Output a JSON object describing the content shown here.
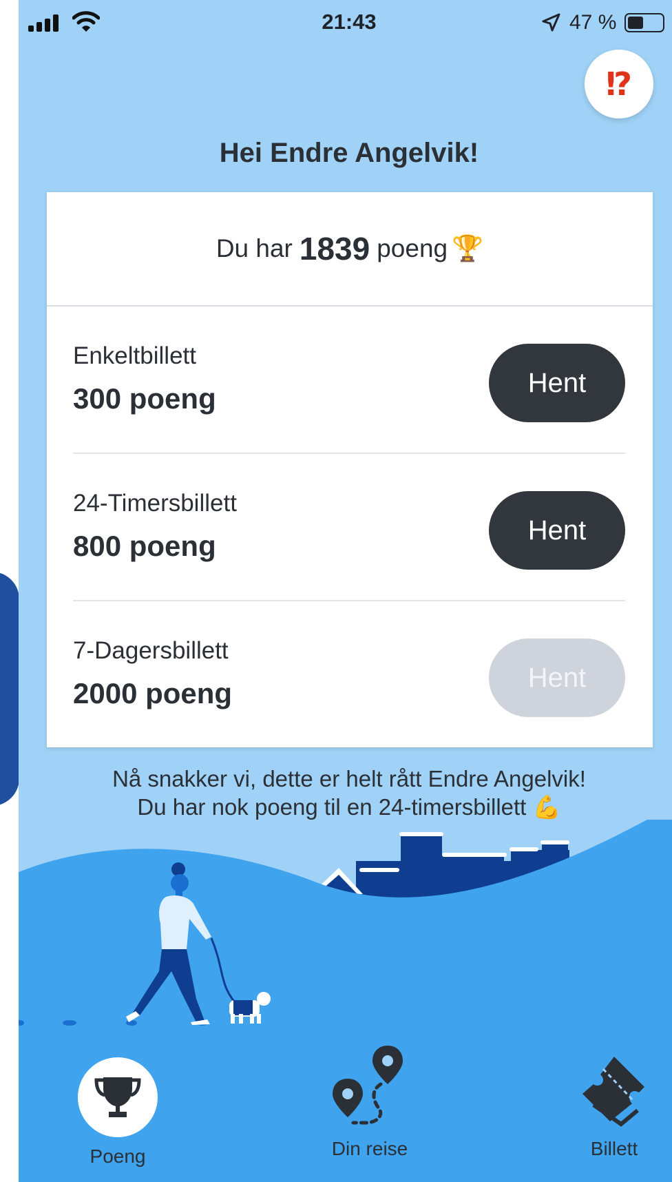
{
  "status_bar": {
    "time": "21:43",
    "battery": "47 %"
  },
  "help_button": {
    "label": "⁉"
  },
  "greeting": "Hei Endre Angelvik!",
  "points": {
    "prefix": "Du har",
    "value": "1839",
    "suffix": "poeng",
    "emoji": "🏆"
  },
  "offers": [
    {
      "name": "Enkeltbillett",
      "points": "300 poeng",
      "button": "Hent",
      "enabled": true
    },
    {
      "name": "24-Timersbillett",
      "points": "800 poeng",
      "button": "Hent",
      "enabled": true
    },
    {
      "name": "7-Dagersbillett",
      "points": "2000 poeng",
      "button": "Hent",
      "enabled": false
    }
  ],
  "message": {
    "line1": "Nå snakker vi, dette er helt rått Endre Angelvik!",
    "line2": "Du har nok poeng til en 24-timersbillett",
    "emoji": "💪"
  },
  "tabs": [
    {
      "label": "Poeng",
      "icon": "trophy-icon",
      "active": true
    },
    {
      "label": "Din reise",
      "icon": "route-icon",
      "active": false
    },
    {
      "label": "Billett",
      "icon": "ticket-icon",
      "active": false
    }
  ],
  "colors": {
    "background": "#9fd2f6",
    "ground": "#3fa3ee",
    "dark_button": "#32363d",
    "disabled_button": "#cfd4dc",
    "accent_red": "#e0331c"
  }
}
